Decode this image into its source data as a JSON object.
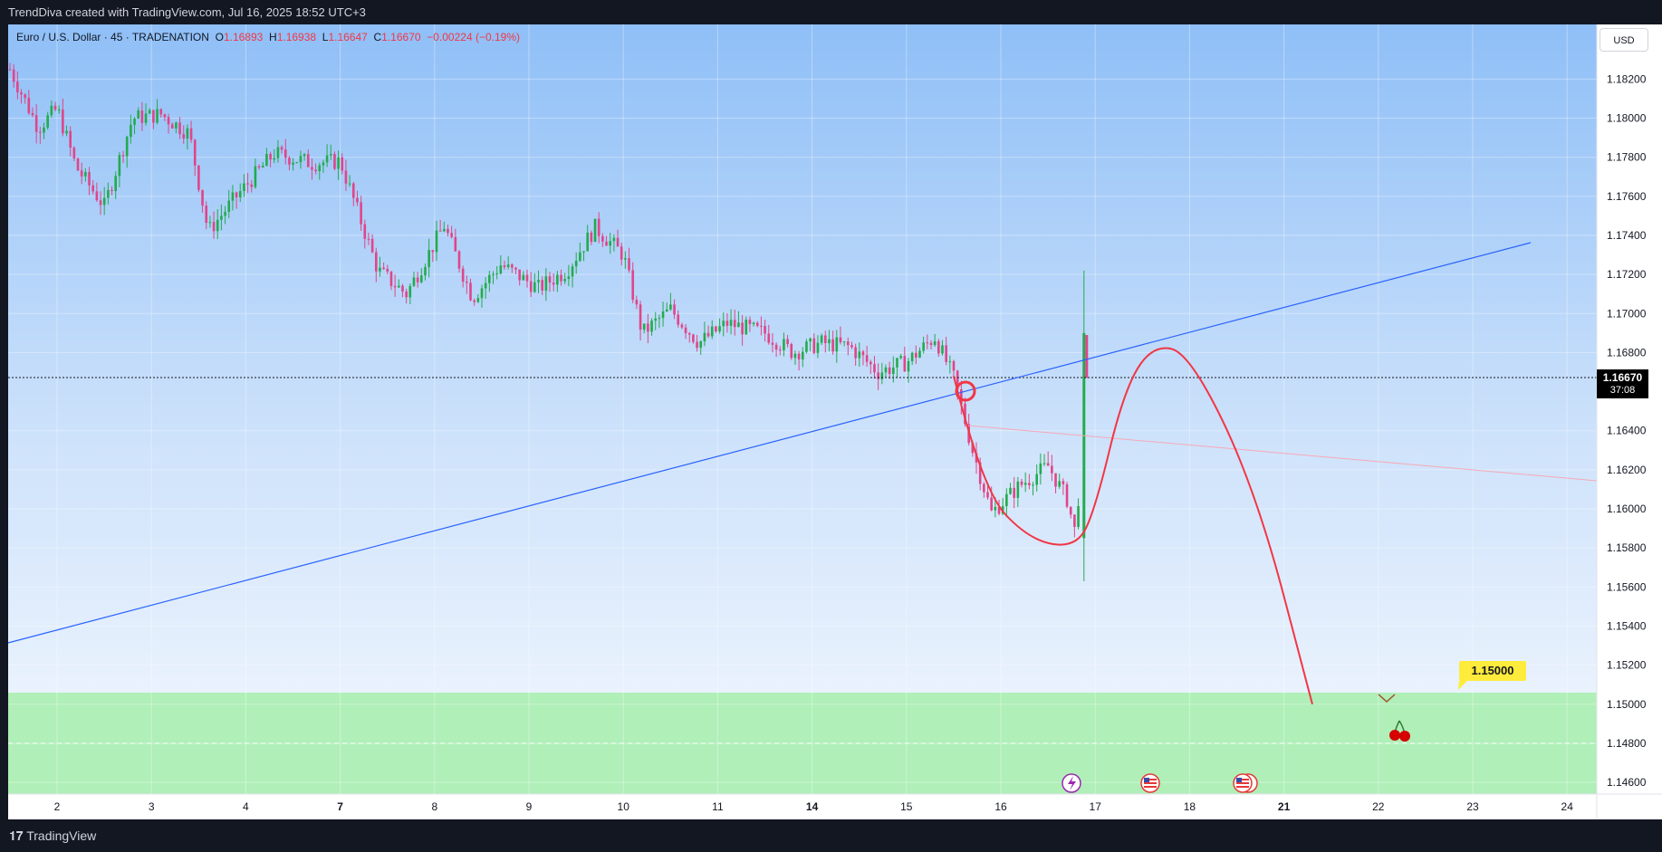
{
  "header": {
    "credit": "TrendDiva created with TradingView.com, Jul 16, 2025 18:52 UTC+3"
  },
  "legend": {
    "symbol": "Euro / U.S. Dollar · 45 · TRADENATION",
    "o_label": "O",
    "o_value": "1.16893",
    "h_label": "H",
    "h_value": "1.16938",
    "l_label": "L",
    "l_value": "1.16647",
    "c_label": "C",
    "c_value": "1.16670",
    "change": "−0.00224 (−0.19%)"
  },
  "currency_button": "USD",
  "last_price": {
    "price": "1.16670",
    "countdown": "37:08"
  },
  "target_label": "1.15000",
  "footer": {
    "brand": "TradingView"
  },
  "colors": {
    "bull": "#22ab4e",
    "bear": "#e0458a",
    "trendline": "#2962ff",
    "projection": "#f23645",
    "target_zone": "#b0efb8",
    "label_bg": "#ffeb3b"
  },
  "icons": [
    "lightning-event-icon",
    "us-flag-event-icon",
    "us-flag-event-icon",
    "cherry-icon"
  ],
  "chart_data": {
    "type": "candlestick",
    "symbol": "EURUSD",
    "timeframe": "45",
    "y_ticks": [
      "1.18200",
      "1.18000",
      "1.17800",
      "1.17600",
      "1.17400",
      "1.17200",
      "1.17000",
      "1.16800",
      "1.16400",
      "1.16200",
      "1.16000",
      "1.15800",
      "1.15600",
      "1.15400",
      "1.15200",
      "1.15000",
      "1.14800",
      "1.14600"
    ],
    "x_ticks": [
      "2",
      "3",
      "4",
      "7",
      "8",
      "9",
      "10",
      "11",
      "14",
      "15",
      "16",
      "17",
      "18",
      "21",
      "22",
      "23",
      "24"
    ],
    "ylim": [
      1.1454,
      1.1848
    ],
    "close_path": [
      {
        "x": 0.0,
        "y": 1.1825
      },
      {
        "x": 0.3,
        "y": 1.1795
      },
      {
        "x": 0.5,
        "y": 1.1805
      },
      {
        "x": 0.7,
        "y": 1.1775
      },
      {
        "x": 1.0,
        "y": 1.1755
      },
      {
        "x": 1.3,
        "y": 1.18
      },
      {
        "x": 1.6,
        "y": 1.1802
      },
      {
        "x": 1.9,
        "y": 1.1792
      },
      {
        "x": 2.1,
        "y": 1.1742
      },
      {
        "x": 2.4,
        "y": 1.176
      },
      {
        "x": 2.8,
        "y": 1.1782
      },
      {
        "x": 3.2,
        "y": 1.1777
      },
      {
        "x": 3.5,
        "y": 1.1778
      },
      {
        "x": 3.9,
        "y": 1.1722
      },
      {
        "x": 4.2,
        "y": 1.171
      },
      {
        "x": 4.6,
        "y": 1.1745
      },
      {
        "x": 4.9,
        "y": 1.1708
      },
      {
        "x": 5.2,
        "y": 1.1725
      },
      {
        "x": 5.6,
        "y": 1.1713
      },
      {
        "x": 5.9,
        "y": 1.1722
      },
      {
        "x": 6.2,
        "y": 1.1744
      },
      {
        "x": 6.5,
        "y": 1.173
      },
      {
        "x": 6.7,
        "y": 1.169
      },
      {
        "x": 7.0,
        "y": 1.1702
      },
      {
        "x": 7.3,
        "y": 1.1685
      },
      {
        "x": 7.6,
        "y": 1.1695
      },
      {
        "x": 8.0,
        "y": 1.169
      },
      {
        "x": 8.3,
        "y": 1.168
      },
      {
        "x": 8.6,
        "y": 1.1685
      },
      {
        "x": 8.9,
        "y": 1.1683
      },
      {
        "x": 9.2,
        "y": 1.167
      },
      {
        "x": 9.5,
        "y": 1.1675
      },
      {
        "x": 9.8,
        "y": 1.1688
      },
      {
        "x": 10.0,
        "y": 1.1667
      },
      {
        "x": 10.2,
        "y": 1.163
      },
      {
        "x": 10.4,
        "y": 1.1598
      },
      {
        "x": 10.7,
        "y": 1.1612
      },
      {
        "x": 11.0,
        "y": 1.1622
      },
      {
        "x": 11.2,
        "y": 1.1605
      },
      {
        "x": 11.3,
        "y": 1.1585
      },
      {
        "x": 11.38,
        "y": 1.1667
      }
    ],
    "projection_path": [
      {
        "x": 11.5,
        "y": 1.16
      },
      {
        "x": 11.8,
        "y": 1.166
      },
      {
        "x": 12.1,
        "y": 1.1684
      },
      {
        "x": 12.5,
        "y": 1.168
      },
      {
        "x": 13.2,
        "y": 1.161
      },
      {
        "x": 13.8,
        "y": 1.15
      }
    ],
    "annotations": {
      "target_price": "1.15000",
      "target_zone": [
        1.1454,
        1.1502
      ],
      "dashed_level": 1.1475
    }
  }
}
